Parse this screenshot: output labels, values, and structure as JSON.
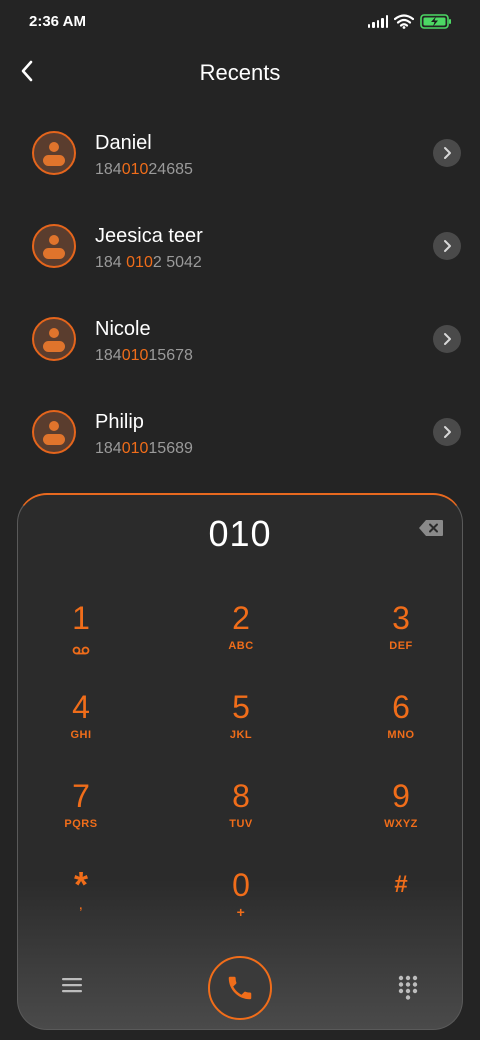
{
  "status_bar": {
    "time": "2:36 AM"
  },
  "header": {
    "title": "Recents"
  },
  "contacts": [
    {
      "name": "Daniel",
      "number_before": "184",
      "number_match": "010",
      "number_after": "24685"
    },
    {
      "name": "Jeesica teer",
      "number_before": "184 ",
      "number_match": "010",
      "number_after": "2 5042"
    },
    {
      "name": "Nicole",
      "number_before": "184",
      "number_match": "010",
      "number_after": "15678"
    },
    {
      "name": "Philip",
      "number_before": "184",
      "number_match": "010",
      "number_after": "15689"
    }
  ],
  "dialpad": {
    "display": "010",
    "keys": [
      {
        "digit": "1",
        "sub": ""
      },
      {
        "digit": "2",
        "sub": "ABC"
      },
      {
        "digit": "3",
        "sub": "DEF"
      },
      {
        "digit": "4",
        "sub": "GHI"
      },
      {
        "digit": "5",
        "sub": "JKL"
      },
      {
        "digit": "6",
        "sub": "MNO"
      },
      {
        "digit": "7",
        "sub": "PQRS"
      },
      {
        "digit": "8",
        "sub": "TUV"
      },
      {
        "digit": "9",
        "sub": "WXYZ"
      },
      {
        "digit": "*",
        "sub": ","
      },
      {
        "digit": "0",
        "sub": "+"
      },
      {
        "digit": "#",
        "sub": ""
      }
    ]
  },
  "colors": {
    "background": "#242424",
    "accent": "#f06d1a",
    "battery": "#4cd964"
  },
  "icons": {
    "voicemail": "voicemail-icon",
    "back": "back-arrow-icon",
    "chevron": "chevron-right-icon",
    "backspace": "backspace-icon",
    "menu": "menu-icon",
    "call": "phone-icon",
    "keypad": "keypad-icon"
  }
}
